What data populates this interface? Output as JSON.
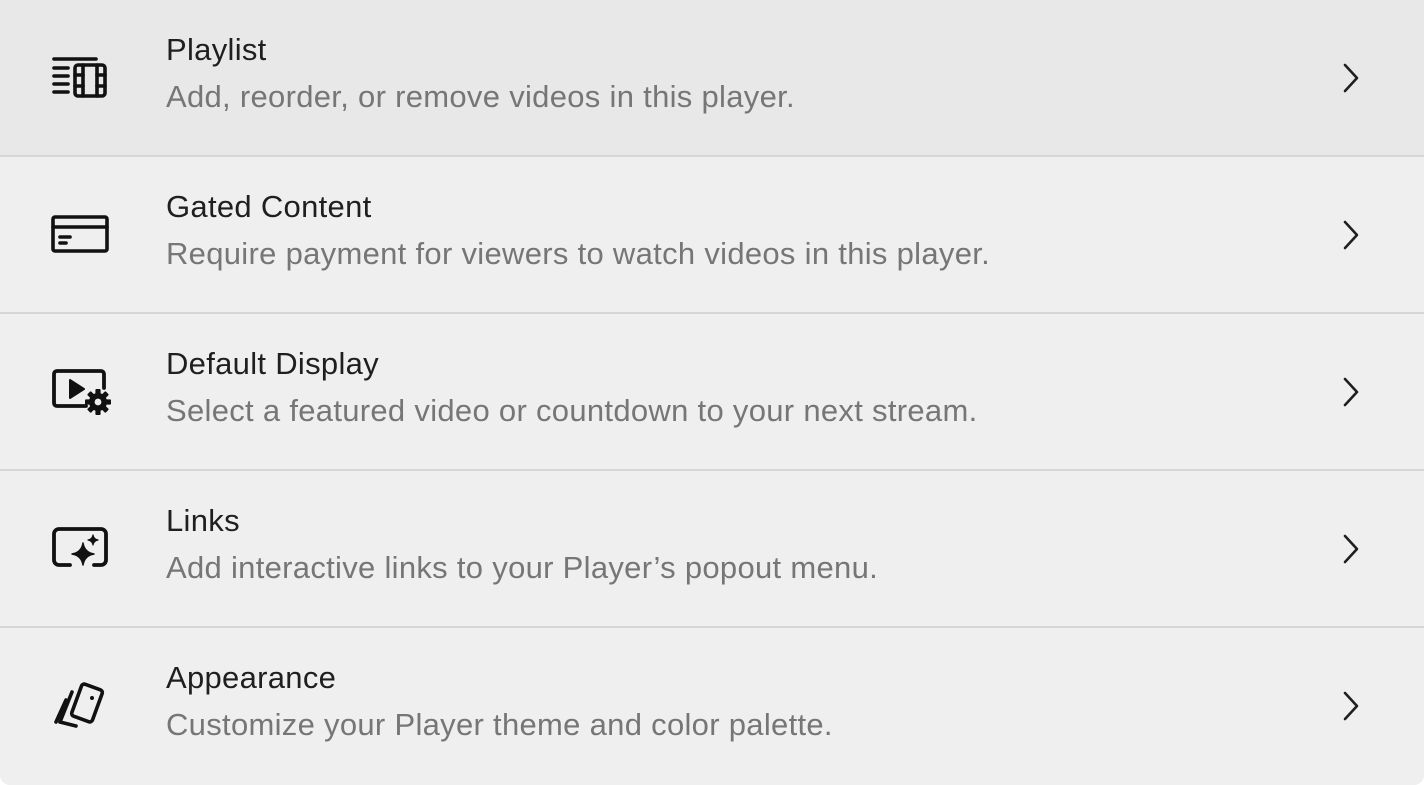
{
  "menu": {
    "items": [
      {
        "id": "playlist",
        "icon": "playlist-icon",
        "title": "Playlist",
        "description": "Add, reorder, or remove videos in this player."
      },
      {
        "id": "gated-content",
        "icon": "credit-card-icon",
        "title": "Gated Content",
        "description": "Require payment for viewers to watch videos in this player."
      },
      {
        "id": "default-display",
        "icon": "video-settings-icon",
        "title": "Default Display",
        "description": "Select a featured video or countdown to your next stream."
      },
      {
        "id": "links",
        "icon": "sparkle-frame-icon",
        "title": "Links",
        "description": "Add interactive links to your Player’s popout menu."
      },
      {
        "id": "appearance",
        "icon": "swatches-icon",
        "title": "Appearance",
        "description": "Customize your Player theme and color palette."
      }
    ],
    "chevron_icon": "chevron-right-icon"
  },
  "colors": {
    "background": "#efefef",
    "divider": "#d6d6d6",
    "title": "#1f1f1f",
    "description": "#767676",
    "icon": "#111111"
  }
}
